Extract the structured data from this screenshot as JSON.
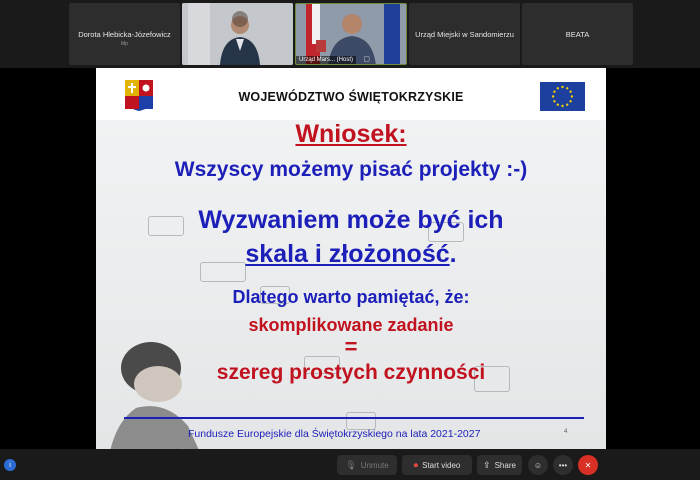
{
  "gallery": {
    "tiles": [
      {
        "name": "Dorota Hlebicka-Józefowicz",
        "sub": "Mp"
      },
      {
        "name": ""
      },
      {
        "name": "Urząd Mars... (Host)"
      },
      {
        "name": "Urząd Miejski w Sandomierzu"
      },
      {
        "name": "BEATA"
      }
    ]
  },
  "slide": {
    "header_title": "WOJEWÓDZTWO ŚWIĘTOKRZYSKIE",
    "line1": "Wniosek:",
    "line2": "Wszyscy możemy pisać projekty  :-)",
    "line3": "Wyzwaniem może być ich",
    "line4": "skala i złożoność",
    "line4_suffix": ".",
    "line5": "Dlatego warto pamiętać, że:",
    "line6": "skomplikowane zadanie",
    "line7": "=",
    "line8": "szereg prostych czynności",
    "footer": "Fundusze Europejskie dla Świętokrzyskiego na lata 2021-2027",
    "page_number": "4"
  },
  "toolbar": {
    "unmute": "Unmute",
    "start_video": "Start video",
    "share": "Share",
    "reactions_icon": "smile-icon",
    "more_icon": "more-icon",
    "leave_icon": "close-icon"
  },
  "colors": {
    "red": "#c1121f",
    "blue": "#1c1fb8",
    "leave": "#d93025"
  }
}
